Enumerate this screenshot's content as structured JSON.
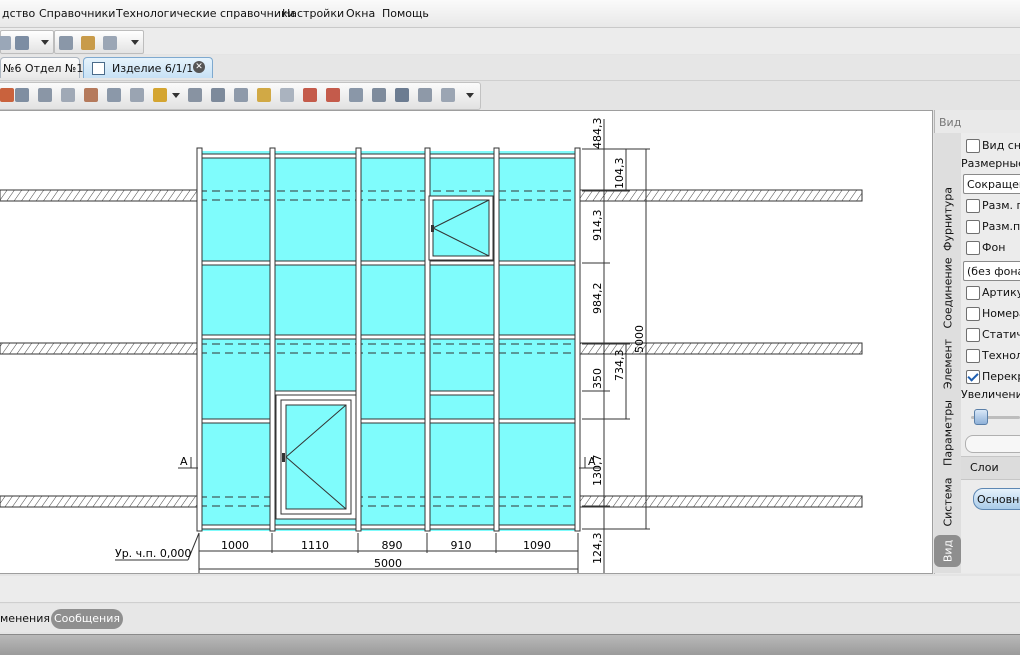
{
  "menu": [
    "дство",
    "Справочники",
    "Технологические справочники",
    "Настройки",
    "Окна",
    "Помощь"
  ],
  "tabs": [
    {
      "label": "№6 Отдел №1",
      "active": false
    },
    {
      "label": "Изделие 6/1/1",
      "active": true
    }
  ],
  "drawing": {
    "glass_color": "#7ffcfc",
    "floor_label": "Ур. ч.п. 0,000",
    "section_mark_left": "А",
    "section_mark_right": "А",
    "bottom_widths": [
      "1000",
      "1110",
      "890",
      "910",
      "1090"
    ],
    "bottom_total": "5000",
    "right_dims": [
      "484,3",
      "104,3",
      "914,3",
      "984,2",
      "734,3",
      "350",
      "130,7",
      "124,3"
    ],
    "right_total": "5000"
  },
  "right_panel": {
    "header": "Вид",
    "vertical_tabs": [
      "Фурнитура",
      "Соединение",
      "Элемент",
      "Параметры",
      "Система",
      "Вид"
    ],
    "active_tab": "Вид",
    "items": {
      "view_snap": "Вид сна",
      "dim_header": "Размерные",
      "dim_combo": "Сокращенн",
      "dim_pos1": "Разм. по",
      "dim_pos2": "Разм.по",
      "background": "Фон",
      "background_combo": "(без фона)",
      "article": "Артику",
      "numbers": "Номера",
      "static": "Статич",
      "techno": "Техноло",
      "overlap": "Перекр",
      "zoom": "Увеличение",
      "layers": "Слои",
      "base_layer": "Основно"
    }
  },
  "bottom": {
    "changes_tab": "менения",
    "messages_tab": "Сообщения"
  }
}
